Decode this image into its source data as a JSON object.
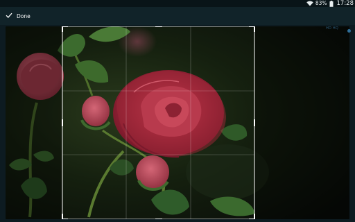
{
  "status_bar": {
    "wifi_icon": "wifi-icon",
    "battery_percent": "83%",
    "battery_icon": "battery-icon",
    "time": "17:28"
  },
  "action_bar": {
    "done_label": "Done",
    "done_icon": "checkmark-icon"
  },
  "editor": {
    "hq_label": "HD HQ",
    "accent_color": "#2f6f99",
    "crop_grid": "3x3"
  }
}
